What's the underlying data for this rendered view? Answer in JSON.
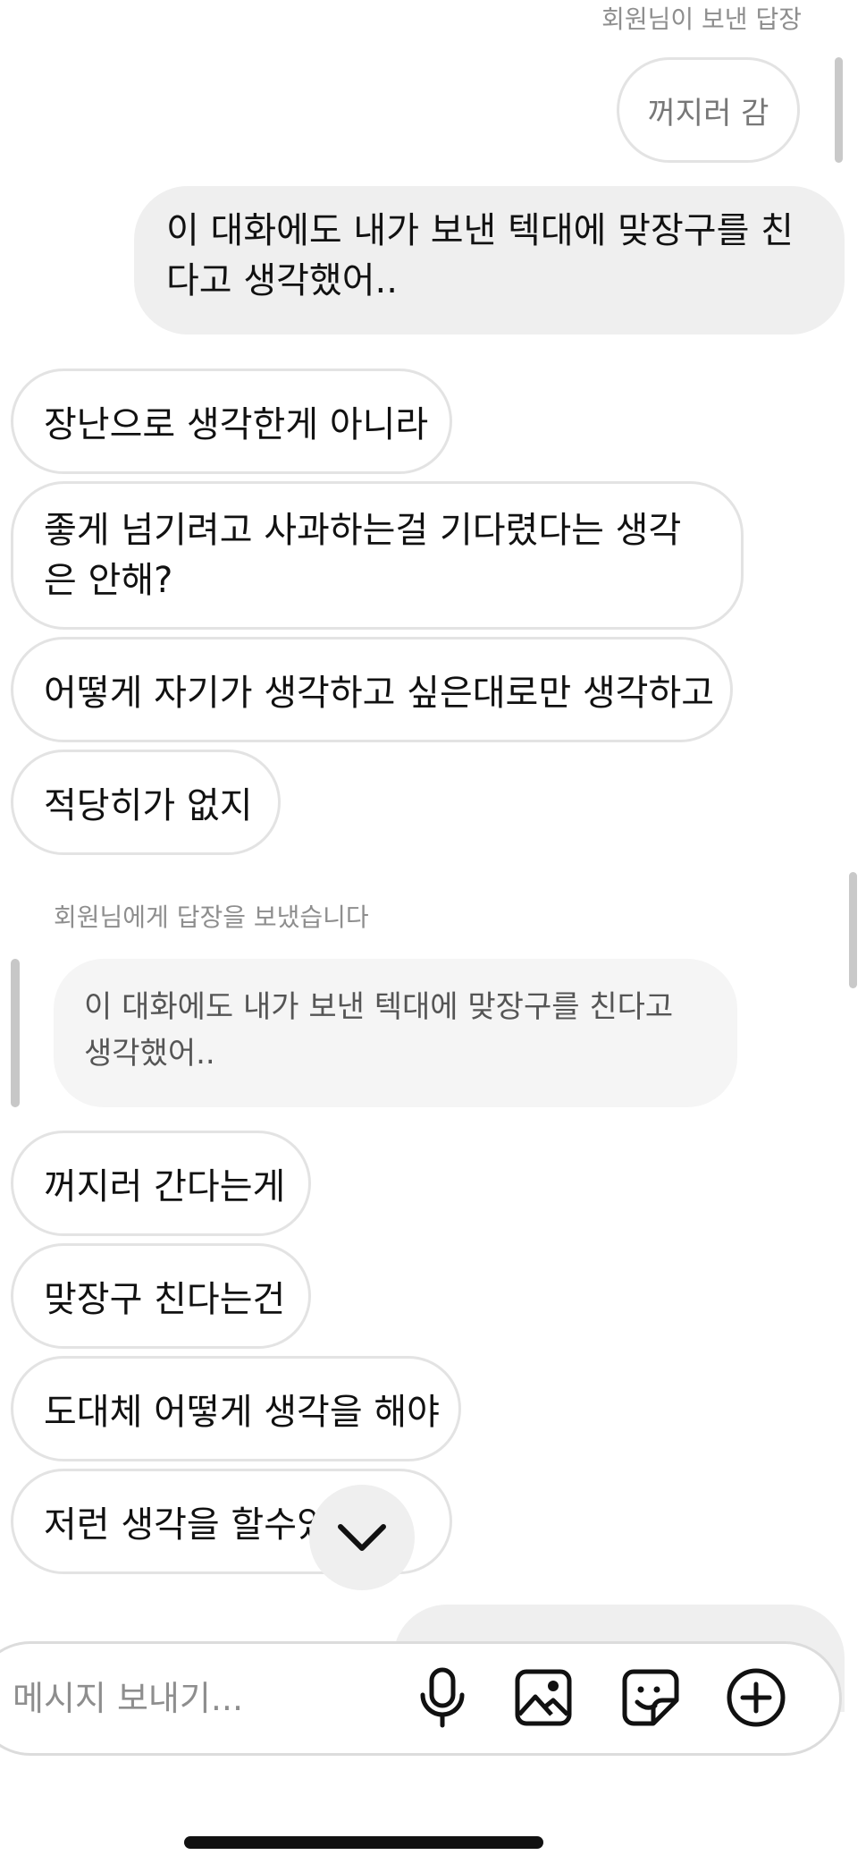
{
  "header_reply_label": "회원님이 보낸 답장",
  "reply_quote_out": "꺼지러 감",
  "message_out_1": "이 대화에도 내가 보낸 텍대에 맞장구를 친다고 생각했어..",
  "incoming_1": [
    "장난으로 생각한게 아니라",
    "좋게 넘기려고 사과하는걸 기다렸다는 생각은 안해?",
    "어떻게 자기가 생각하고 싶은대로만 생각하고",
    "적당히가 없지"
  ],
  "reply_label_in": "회원님에게 답장을 보냈습니다",
  "reply_quote_in": "이 대화에도 내가 보낸 텍대에 맞장구를 친다고 생각했어..",
  "incoming_2": [
    "꺼지러 간다는게",
    "맞장구 친다는건",
    "도대체 어떻게 생각을 해야",
    "저런 생각을 할수있냐"
  ],
  "composer": {
    "placeholder": "메시지 보내기..."
  },
  "icons": {
    "mic": "mic-icon",
    "image": "image-icon",
    "sticker": "sticker-icon",
    "plus": "plus-circle-icon",
    "scroll_down": "chevron-down-icon"
  },
  "colors": {
    "outgoing_bubble": "#efefef",
    "incoming_border": "#e3e3e3",
    "muted_text": "#8e8e8e"
  }
}
